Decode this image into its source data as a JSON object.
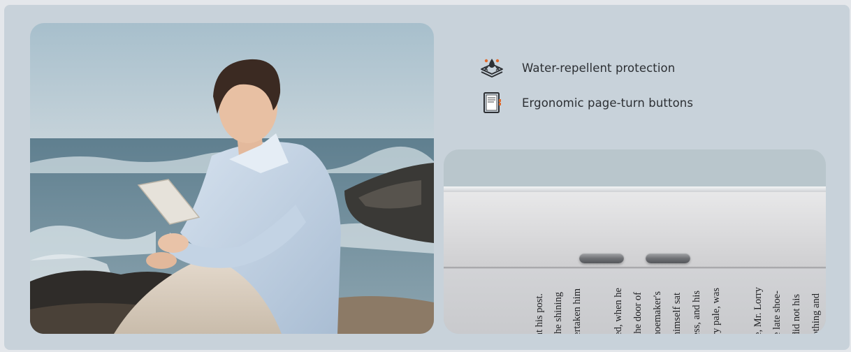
{
  "features": [
    {
      "icon": "water-drop-shield-icon",
      "label": "Water-repellent protection"
    },
    {
      "icon": "ereader-device-icon",
      "label": "Ergonomic page-turn buttons"
    }
  ],
  "photo": {
    "subject": "man reading e-reader on seaside rocks"
  },
  "closeup": {
    "buttons": [
      "page-back",
      "page-forward"
    ],
    "text_lines": [
      "at his post.",
      "the shining",
      "ertaken him",
      "ed, when he",
      "the door of",
      "hoemaker's",
      "himself sat",
      "ess, and his",
      "ry pale, was",
      "e, Mr. Lorry",
      "e late shoe-",
      "did not his",
      "othing and"
    ]
  },
  "colors": {
    "panel": "#c8d2da",
    "text": "#2c2f33",
    "icon_accent": "#e06a2c"
  }
}
